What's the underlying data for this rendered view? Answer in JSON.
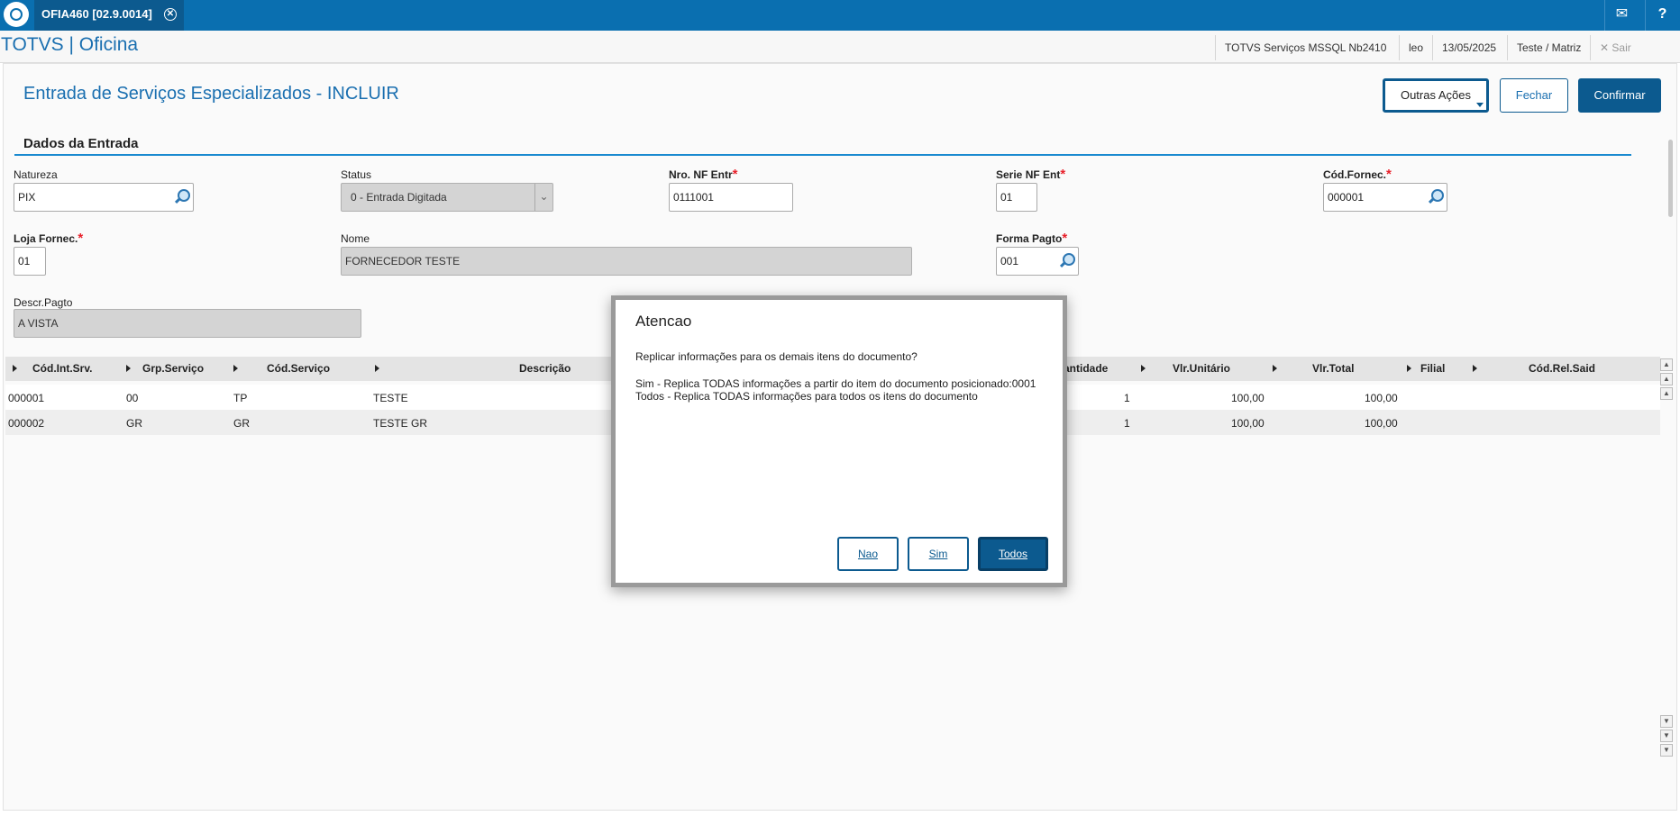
{
  "topbar": {
    "tab_label": "OFIA460 [02.9.0014]",
    "tab_close_glyph": "✕",
    "mail_glyph": "✉",
    "help_glyph": "?"
  },
  "header": {
    "app_title": "TOTVS | Oficina",
    "environment": "TOTVS Serviços MSSQL Nb2410",
    "user": "leo",
    "date": "13/05/2025",
    "company": "Teste / Matriz",
    "exit_label": "Sair",
    "exit_glyph": "✕"
  },
  "page": {
    "title": "Entrada de Serviços Especializados - INCLUIR",
    "actions": {
      "more": "Outras Ações",
      "close": "Fechar",
      "confirm": "Confirmar"
    },
    "section": "Dados da Entrada"
  },
  "form": {
    "natureza": {
      "label": "Natureza",
      "value": "PIX"
    },
    "status": {
      "label": "Status",
      "value": "0 - Entrada Digitada"
    },
    "nro_nf": {
      "label": "Nro. NF Entr",
      "value": "0111001"
    },
    "serie_nf": {
      "label": "Serie NF Ent",
      "value": "01"
    },
    "cod_fornec": {
      "label": "Cód.Fornec.",
      "value": "000001"
    },
    "loja_fornec": {
      "label": "Loja Fornec.",
      "value": "01"
    },
    "nome": {
      "label": "Nome",
      "value": "FORNECEDOR TESTE"
    },
    "forma_pagto": {
      "label": "Forma Pagto",
      "value": "001"
    },
    "descr_pagto": {
      "label": "Descr.Pagto",
      "value": "A VISTA"
    },
    "required_mark": "*"
  },
  "grid": {
    "columns": [
      "Cód.Int.Srv.",
      "Grp.Serviço",
      "Cód.Serviço",
      "Descrição",
      "antidade",
      "Vlr.Unitário",
      "Vlr.Total",
      "Filial",
      "Cód.Rel.Said"
    ],
    "rows": [
      {
        "cod_int": "000001",
        "grp": "00",
        "cod_srv": "TP",
        "descricao": "TESTE",
        "qtd": "1",
        "vlr_unit": "100,00",
        "vlr_total": "100,00"
      },
      {
        "cod_int": "000002",
        "grp": "GR",
        "cod_srv": "GR",
        "descricao": "TESTE GR",
        "qtd": "1",
        "vlr_unit": "100,00",
        "vlr_total": "100,00"
      }
    ]
  },
  "modal": {
    "title": "Atencao",
    "question": "Replicar informações para os demais itens do documento?",
    "line1": "Sim - Replica TODAS informações a partir do item do documento posicionado:0001",
    "line2": "Todos - Replica TODAS informações para todos os itens do documento",
    "btn_no": "Nao",
    "btn_yes": "Sim",
    "btn_all": "Todos"
  },
  "colors": {
    "topbar": "#0a6fb0",
    "primary": "#0c5a8f",
    "title_blue": "#1a6fb0",
    "required": "#e8202a"
  }
}
